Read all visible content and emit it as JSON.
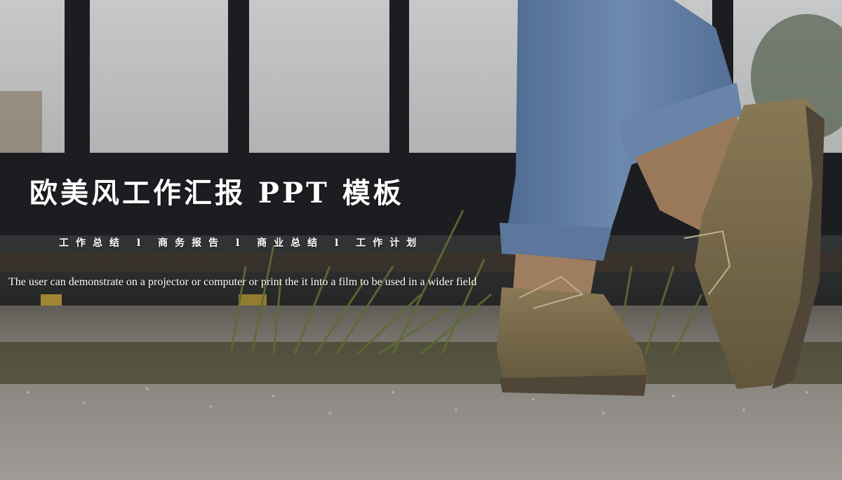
{
  "slide": {
    "title": "欧美风工作汇报 PPT 模板",
    "subtitle": "工作总结 l 商务报告 l 商业总结 l 工作计划",
    "description": "The user can demonstrate on a projector or computer or print the it into a film to be used in a wider field"
  },
  "background": {
    "photo": "feet-in-jeans-and-suede-shoes-by-iron-fence",
    "colors": {
      "sky": "#d9dcdf",
      "fence": "#1f2226",
      "denim": "#6f8fb8",
      "shoe": "#8a7a55",
      "gravel": "#a6a19b",
      "grass": "#5f6a3a"
    }
  }
}
